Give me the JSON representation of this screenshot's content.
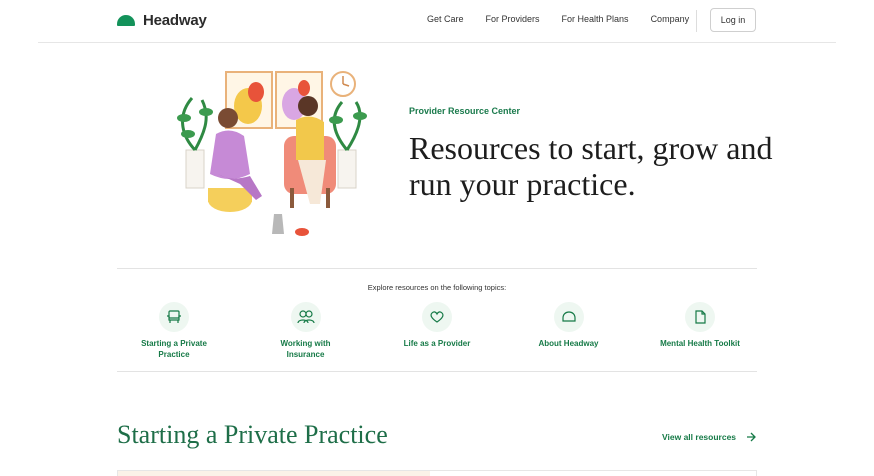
{
  "brand": {
    "name": "Headway",
    "color": "#13925a"
  },
  "nav": {
    "links": [
      "Get Care",
      "For Providers",
      "For Health Plans",
      "Company"
    ],
    "login_label": "Log in"
  },
  "hero": {
    "eyebrow": "Provider Resource Center",
    "headline": "Resources to start, grow and run your practice."
  },
  "topics": {
    "intro": "Explore resources on the following topics:",
    "items": [
      {
        "label": "Starting a Private Practice",
        "icon": "chair-icon"
      },
      {
        "label": "Working with Insurance",
        "icon": "people-icon"
      },
      {
        "label": "Life as a Provider",
        "icon": "heart-icon"
      },
      {
        "label": "About Headway",
        "icon": "headway-logo-icon"
      },
      {
        "label": "Mental Health Toolkit",
        "icon": "document-icon"
      }
    ]
  },
  "section": {
    "title": "Starting a Private Practice",
    "view_all_label": "View all resources"
  },
  "colors": {
    "accent_green": "#167a47",
    "icon_bg": "#eef7f1"
  }
}
